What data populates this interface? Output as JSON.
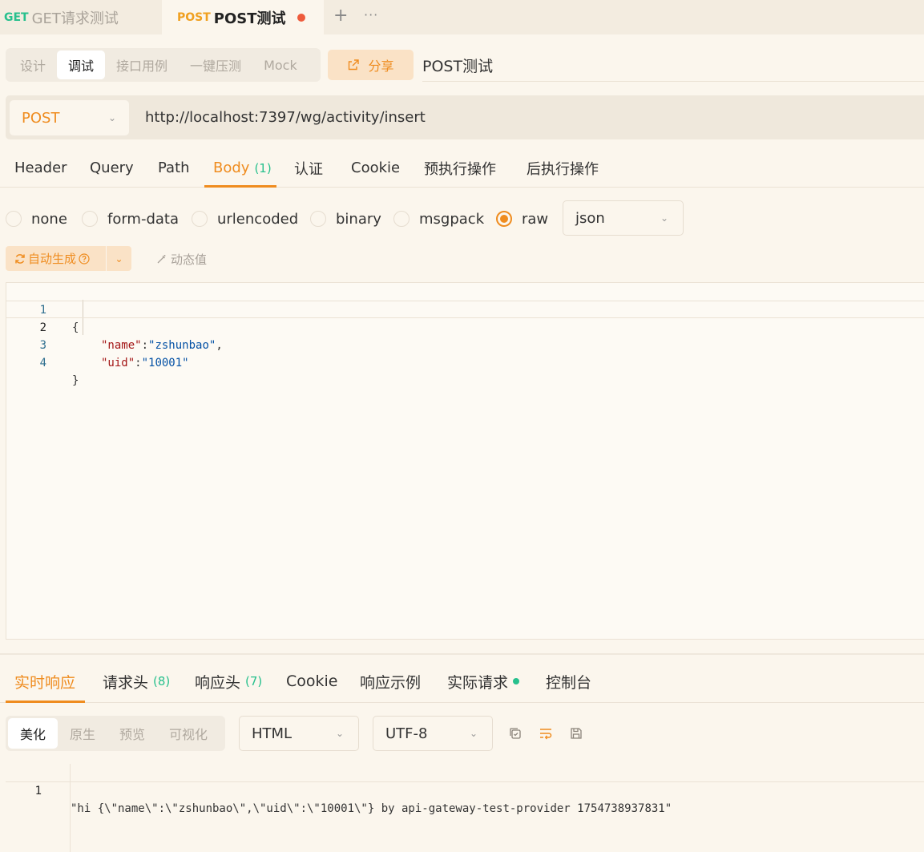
{
  "tabs": [
    {
      "method": "GET",
      "name": "GET请求测试"
    },
    {
      "method": "POST",
      "name": "POST测试"
    }
  ],
  "tab_actions": {
    "add": "+",
    "more": "···"
  },
  "mode_tabs": [
    "设计",
    "调试",
    "接口用例",
    "一键压测",
    "Mock"
  ],
  "share_label": "分享",
  "api_name": "POST测试",
  "request": {
    "method": "POST",
    "url": "http://localhost:7397/wg/activity/insert"
  },
  "request_tabs": {
    "header": "Header",
    "query": "Query",
    "path": "Path",
    "body": "Body",
    "body_count": "(1)",
    "auth": "认证",
    "cookie": "Cookie",
    "pre": "预执行操作",
    "post": "后执行操作"
  },
  "body_types": [
    "none",
    "form-data",
    "urlencoded",
    "binary",
    "msgpack",
    "raw"
  ],
  "body_format": "json",
  "auto_generate": "自动生成",
  "dynamic_value": "动态值",
  "code": {
    "line_numbers": [
      "1",
      "2",
      "3",
      "4"
    ],
    "open_brace": "{",
    "close_brace": "}",
    "name_key": "\"name\"",
    "name_value": "\"zshunbao\"",
    "uid_key": "\"uid\"",
    "uid_value": "\"10001\"",
    "colon": ":",
    "comma": ","
  },
  "response_tabs": {
    "realtime": "实时响应",
    "req_headers": "请求头",
    "req_headers_count": "(8)",
    "resp_headers": "响应头",
    "resp_headers_count": "(7)",
    "cookie": "Cookie",
    "example": "响应示例",
    "actual": "实际请求",
    "console": "控制台"
  },
  "view_modes": [
    "美化",
    "原生",
    "预览",
    "可视化"
  ],
  "response_format": "HTML",
  "response_encoding": "UTF-8",
  "response": {
    "line_number": "1",
    "text": "\"hi {\\\"name\\\":\\\"zshunbao\\\",\\\"uid\\\":\\\"10001\\\"} by api-gateway-test-provider 1754738937831\""
  },
  "colors": {
    "accent": "#ef8c1f",
    "get": "#27c08d",
    "unsaved": "#ee5b3c",
    "background": "#fbf6ed"
  }
}
